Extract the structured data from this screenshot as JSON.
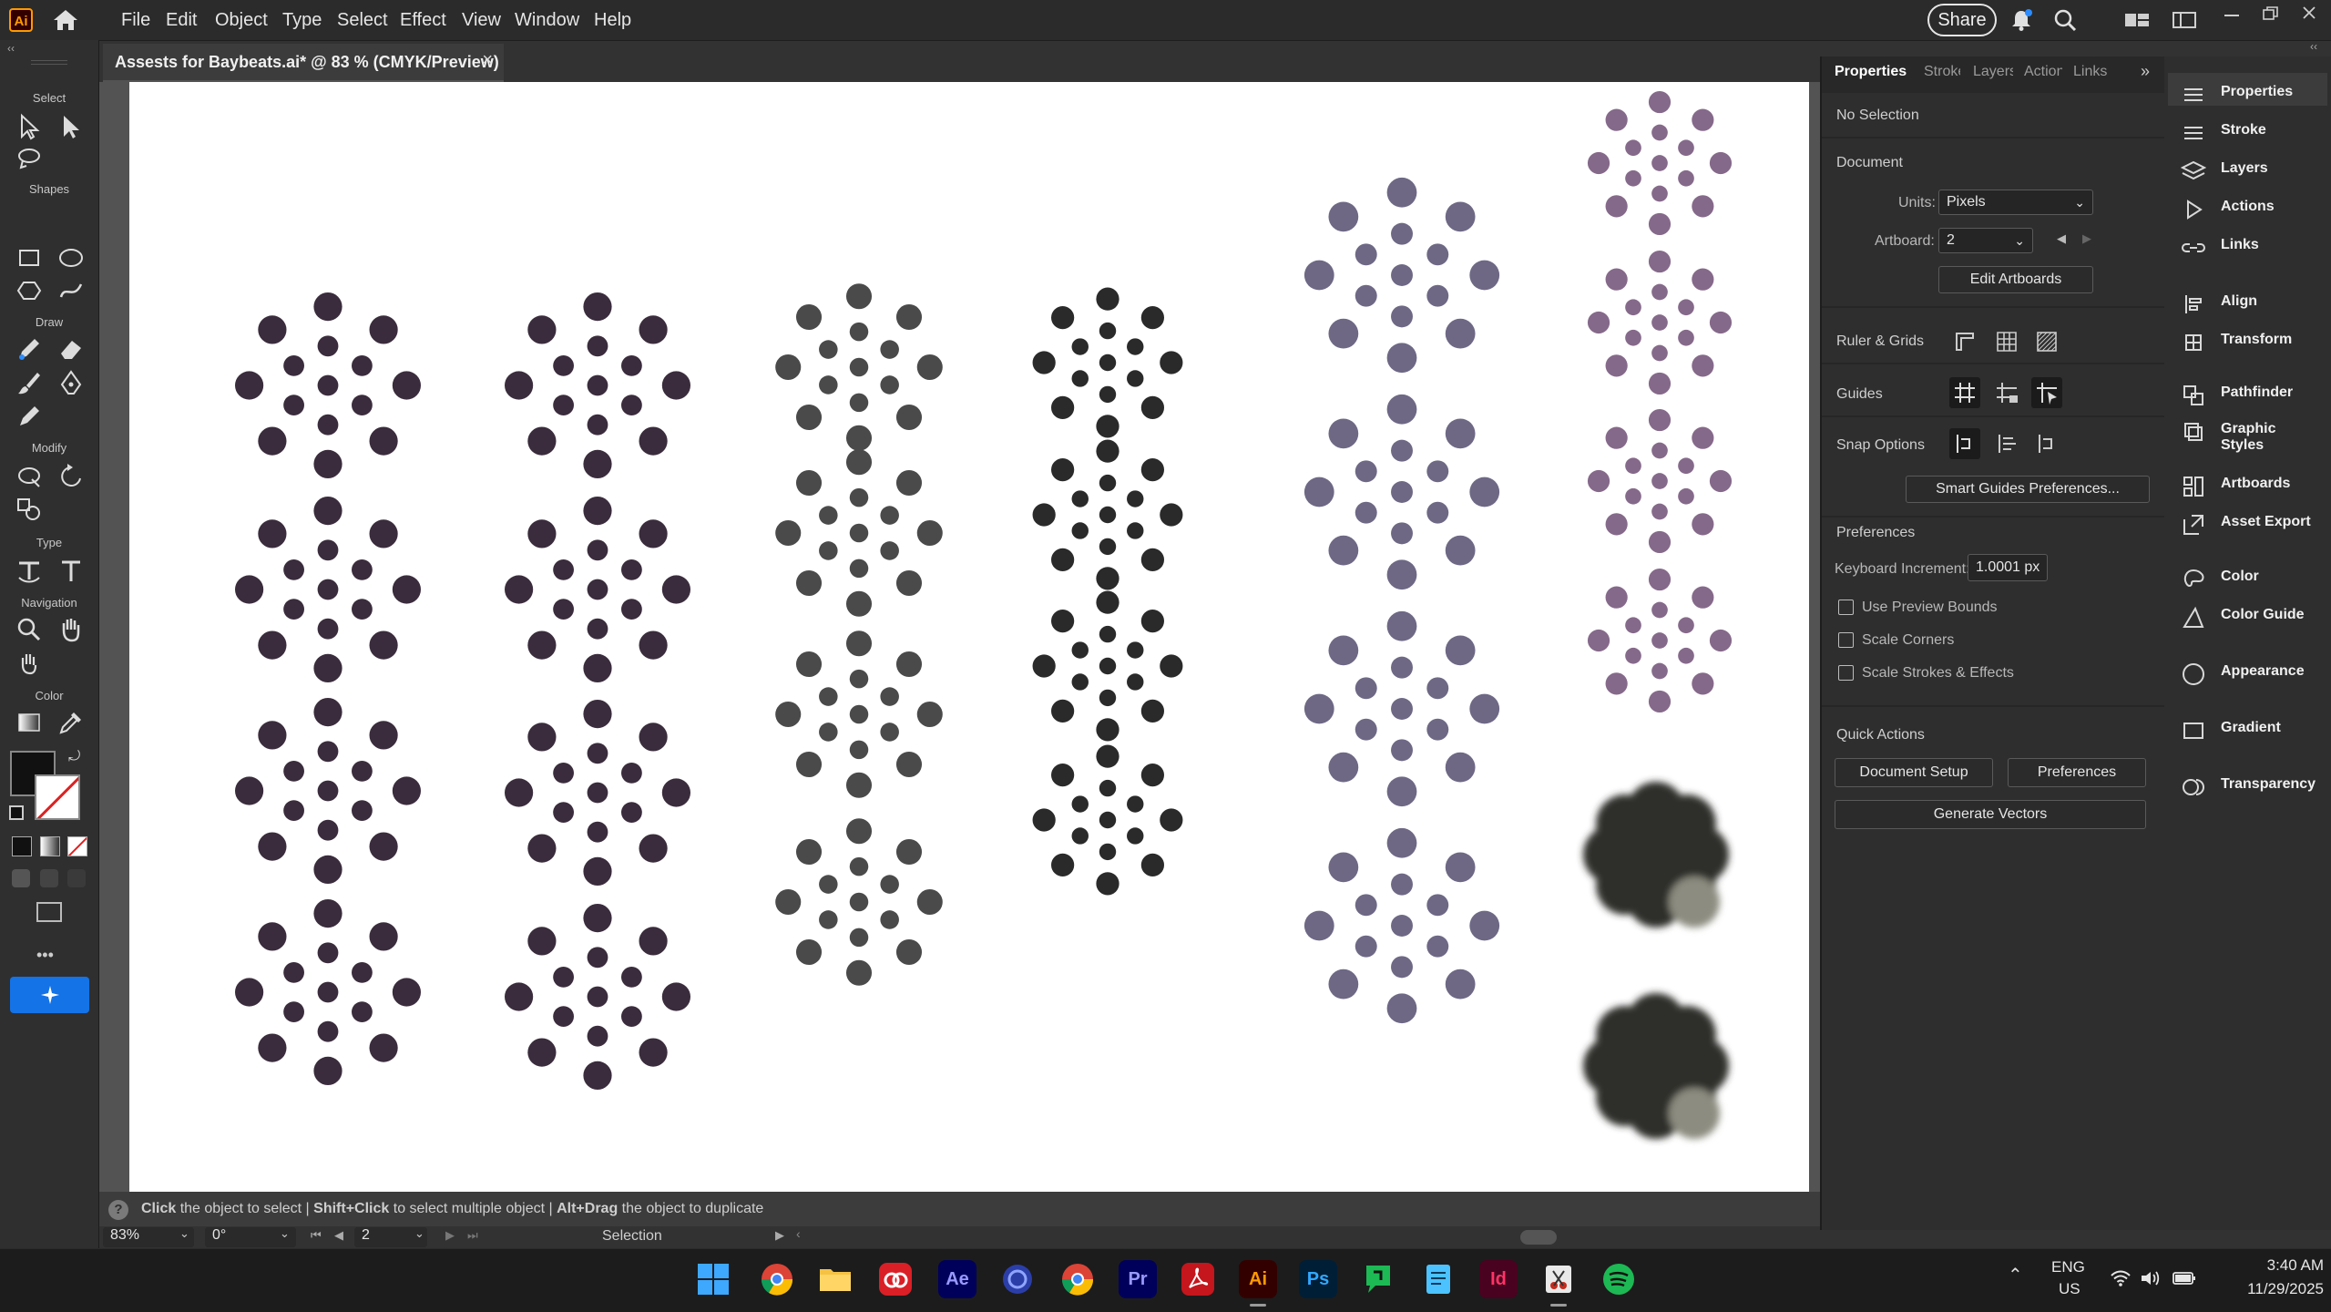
{
  "app": {
    "logo": "Ai",
    "share_label": "Share"
  },
  "menu": [
    "File",
    "Edit",
    "Object",
    "Type",
    "Select",
    "Effect",
    "View",
    "Window",
    "Help"
  ],
  "toolbar": {
    "sections": [
      "Select",
      "Shapes",
      "Draw",
      "Modify",
      "Type",
      "Navigation",
      "Color"
    ],
    "more": "•••"
  },
  "document": {
    "tab_title": "Assests for Baybeats.ai* @ 83 % (CMYK/Preview)",
    "close": "×"
  },
  "status": {
    "hint_click": "Click",
    "hint_click_rest": " the object to select  |  ",
    "hint_shift": "Shift+Click",
    "hint_shift_rest": " to select multiple object  |  ",
    "hint_alt": "Alt+Drag",
    "hint_alt_rest": " the object to duplicate",
    "zoom": "83%",
    "rotation": "0°",
    "artboard": "2",
    "tool": "Selection"
  },
  "properties": {
    "tabs": [
      "Properties",
      "Stroke",
      "Layers",
      "Actions",
      "Links"
    ],
    "no_selection": "No Selection",
    "document_label": "Document",
    "units_label": "Units:",
    "units_value": "Pixels",
    "artboard_label": "Artboard:",
    "artboard_value": "2",
    "edit_artboards": "Edit Artboards",
    "rulers_grids": "Ruler & Grids",
    "guides": "Guides",
    "snap_options": "Snap Options",
    "smart_guides_btn": "Smart Guides Preferences...",
    "preferences_label": "Preferences",
    "keyboard_increment_label": "Keyboard Increment:",
    "keyboard_increment_value": "1.0001 px",
    "use_preview_bounds": "Use Preview Bounds",
    "scale_corners": "Scale Corners",
    "scale_strokes": "Scale Strokes & Effects",
    "quick_actions": "Quick Actions",
    "document_setup": "Document Setup",
    "preferences_btn": "Preferences",
    "generate_vectors": "Generate Vectors"
  },
  "dock": [
    "Properties",
    "Stroke",
    "Layers",
    "Actions",
    "Links",
    "Align",
    "Transform",
    "Pathfinder",
    "Graphic Styles",
    "Artboards",
    "Asset Export",
    "Color",
    "Color Guide",
    "Appearance",
    "Gradient",
    "Transparency"
  ],
  "taskbar": {
    "apps": [
      "windows-start",
      "chrome-beta",
      "file-explorer",
      "creative-cloud",
      "after-effects",
      "app-blue",
      "chrome",
      "premiere-pro",
      "acrobat",
      "illustrator",
      "photoshop",
      "messaging",
      "notepad",
      "indesign",
      "snipping-tool",
      "spotify"
    ],
    "app_labels": {
      "ae": "Ae",
      "pr": "Pr",
      "ai": "Ai",
      "ps": "Ps",
      "id": "Id"
    },
    "lang": "ENG",
    "region": "US",
    "time": "3:40 AM",
    "date": "11/29/2025"
  },
  "colors": {
    "dot_dark_purple": "#3a2c3c",
    "dot_charcoal": "#4a4a4a",
    "dot_near_black": "#2a2a2a",
    "dot_slate_purple": "#6e6885",
    "dot_mauve": "#85698a",
    "blur_dark": "#2e2f2c",
    "blur_light": "#8c8c80",
    "accent_blue": "#1473e6"
  }
}
